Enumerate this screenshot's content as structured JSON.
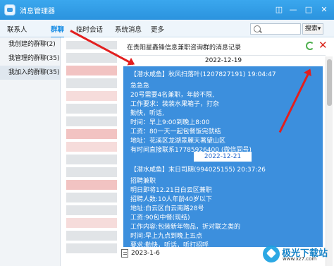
{
  "window": {
    "title": "消息管理器"
  },
  "tabs": [
    "联系人",
    "群聊",
    "临时会话",
    "系统消息",
    "更多"
  ],
  "search": {
    "button_label": "搜索"
  },
  "sidebar": {
    "items": [
      {
        "label": "我创建的群聊(2)"
      },
      {
        "label": "我管理的群聊(35)"
      },
      {
        "label": "我加入的群聊(35)"
      }
    ]
  },
  "panel": {
    "title": "在贵阳星鑫锋信息兼职咨询群的消息记录",
    "date_top": "2022-12-19",
    "message1": {
      "header": "【潜水咸鱼】秋风扫落叶(1207827191) 19:04:47",
      "lines": [
        "急急急",
        "20号需要4名兼职，年龄不限,",
        "工作要求：装装水果箱子，打杂",
        "勤快，听话,",
        "时间：早上9:00到晚上8:00",
        "工资：80一天一起包餐饭完就结",
        "地址：花溪区龙湖景麗天著望山区",
        "有时间直接联系17785926400 (微信同号)"
      ]
    },
    "inner_date": "2022-12-21",
    "message2": {
      "header": "【潜水咸鱼】末日司期(994025155) 20:37:26",
      "lines": [
        "招聘兼职",
        "明日即将12.21日白云区兼职",
        "招聘人数:10人年龄40岁以下",
        "地址:白云区白云南路28号",
        "工资:90包中餐(现结)",
        "工作内容:包装新年物品，折对联之类的",
        "时间:早上九点到晚上五点",
        "要求:勤快，听话，听打招呼"
      ]
    },
    "date_bottom": "2023-1-6"
  },
  "watermark": {
    "text": "极光下载站",
    "url": "www.xz7.com"
  }
}
